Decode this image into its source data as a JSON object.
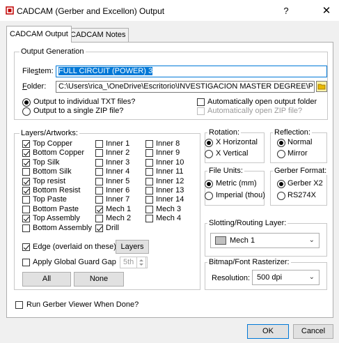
{
  "window": {
    "title": "CADCAM (Gerber and Excellon) Output",
    "help": "?",
    "close": "✕"
  },
  "tabs": [
    "CADCAM Output",
    "CADCAM Notes"
  ],
  "output_generation": {
    "group_label": "Output Generation",
    "filestem_label_pre": "File",
    "filestem_label_u": "s",
    "filestem_label_post": "tem:",
    "filestem_value": "FULL CIRCUIT (POWER) 3",
    "folder_label_pre": "",
    "folder_label_u": "F",
    "folder_label_post": "older:",
    "folder_value": "C:\\Users\\rica_\\OneDrive\\Escritorio\\INVESTIGACION MASTER DEGREE\\PROGRAM",
    "radio_individual": "Output to individual TXT files?",
    "radio_zip": "Output to a single ZIP file?",
    "auto_open_folder": "Automatically open output folder",
    "auto_open_zip": "Automatically open ZIP file?"
  },
  "layers": {
    "group_label": "Layers/Artworks:",
    "col1": [
      {
        "label": "Top Copper",
        "checked": true
      },
      {
        "label": "Bottom Copper",
        "checked": true
      },
      {
        "label": "Top Silk",
        "checked": true
      },
      {
        "label": "Bottom Silk",
        "checked": false
      },
      {
        "label": "Top resist",
        "checked": true
      },
      {
        "label": "Bottom Resist",
        "checked": true
      },
      {
        "label": "Top Paste",
        "checked": false
      },
      {
        "label": "Bottom Paste",
        "checked": false
      },
      {
        "label": "Top Assembly",
        "checked": true
      },
      {
        "label": "Bottom Assembly",
        "checked": false
      }
    ],
    "col2": [
      {
        "label": "Inner 1",
        "checked": false
      },
      {
        "label": "Inner 2",
        "checked": false
      },
      {
        "label": "Inner 3",
        "checked": false
      },
      {
        "label": "Inner 4",
        "checked": false
      },
      {
        "label": "Inner 5",
        "checked": false
      },
      {
        "label": "Inner 6",
        "checked": false
      },
      {
        "label": "Inner 7",
        "checked": false
      },
      {
        "label": "Mech 1",
        "checked": true
      },
      {
        "label": "Mech 2",
        "checked": false
      },
      {
        "label": "Drill",
        "checked": true
      }
    ],
    "col3": [
      {
        "label": "Inner 8",
        "checked": false
      },
      {
        "label": "Inner 9",
        "checked": false
      },
      {
        "label": "Inner 10",
        "checked": false
      },
      {
        "label": "Inner 11",
        "checked": false
      },
      {
        "label": "Inner 12",
        "checked": false
      },
      {
        "label": "Inner 13",
        "checked": false
      },
      {
        "label": "Inner 14",
        "checked": false
      },
      {
        "label": "Mech 3",
        "checked": false
      },
      {
        "label": "Mech 4",
        "checked": false
      }
    ],
    "edge_label": "Edge (overlaid on these)",
    "layers_button": "Layers",
    "guard_gap_label": "Apply Global Guard Gap",
    "guard_gap_value": "5th",
    "all_button": "All",
    "none_button": "None"
  },
  "rotation": {
    "group_label": "Rotation:",
    "options": [
      "X Horizontal",
      "X Vertical"
    ],
    "selected": 0
  },
  "reflection": {
    "group_label": "Reflection:",
    "options": [
      "Normal",
      "Mirror"
    ],
    "selected": 0
  },
  "file_units": {
    "group_label": "File Units:",
    "options": [
      "Metric (mm)",
      "Imperial (thou)"
    ],
    "selected": 0
  },
  "gerber_format": {
    "group_label": "Gerber Format:",
    "options": [
      "Gerber X2",
      "RS274X"
    ],
    "selected": 0
  },
  "slotting": {
    "group_label": "Slotting/Routing Layer:",
    "value": "Mech 1",
    "swatch_color": "#c0c0c0"
  },
  "bitmap": {
    "group_label": "Bitmap/Font Rasterizer:",
    "resolution_label": "Resolution:",
    "resolution_value": "500 dpi"
  },
  "run_viewer": "Run Gerber Viewer When Done?",
  "ok_button": "OK",
  "cancel_button": "Cancel",
  "colors": {
    "accent": "#0078d7",
    "app_icon": "#c00000"
  }
}
